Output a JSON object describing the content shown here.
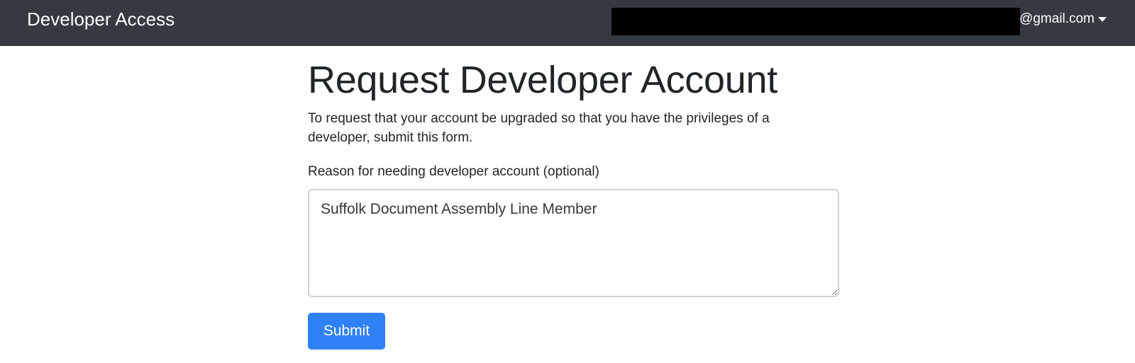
{
  "navbar": {
    "brand": "Developer Access",
    "user_email": "@gmail.com",
    "user_menu_icon": "caret-down-icon",
    "background_color": "#343a40"
  },
  "main": {
    "title": "Request Developer Account",
    "intro": "To request that your account be upgraded so that you have the privileges of a developer, submit this form.",
    "reason_label": "Reason for needing developer account (optional)",
    "reason_value": "Suffolk Document Assembly Line Member",
    "submit_label": "Submit",
    "submit_color": "#2f81f7"
  }
}
